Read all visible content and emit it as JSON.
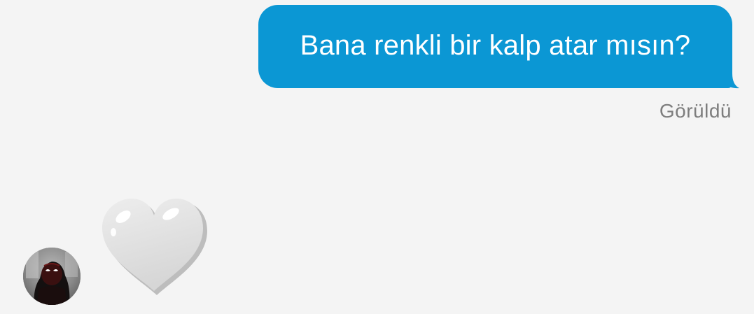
{
  "chat": {
    "sent_message": {
      "text": "Bana renkli bir kalp atar mısın?",
      "status": "Görüldü",
      "bubble_color": "#0b97d4",
      "text_color": "#ffffff"
    },
    "received_message": {
      "emoji": "white-heart-emoji",
      "emoji_color": "#e6e6e6"
    },
    "contact": {
      "avatar_icon": "profile-avatar"
    },
    "background_color": "#f4f4f4"
  }
}
